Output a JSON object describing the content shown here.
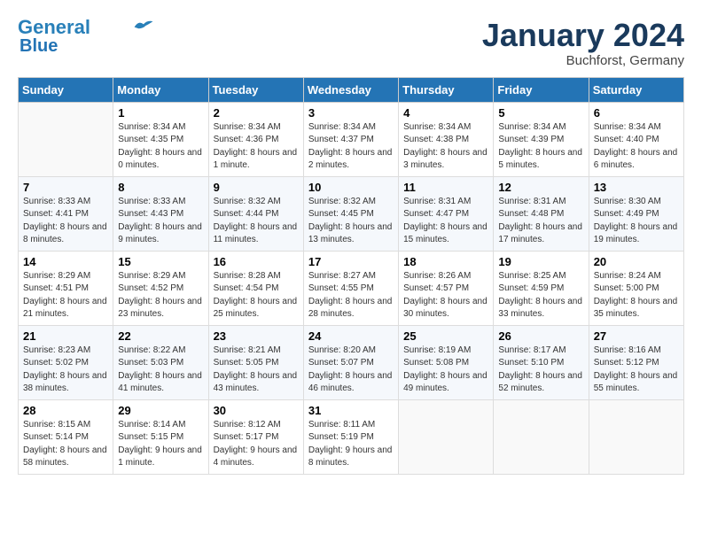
{
  "header": {
    "logo_line1": "General",
    "logo_line2": "Blue",
    "month_title": "January 2024",
    "location": "Buchforst, Germany"
  },
  "weekdays": [
    "Sunday",
    "Monday",
    "Tuesday",
    "Wednesday",
    "Thursday",
    "Friday",
    "Saturday"
  ],
  "weeks": [
    [
      {
        "day": "",
        "empty": true
      },
      {
        "day": "1",
        "sunrise": "8:34 AM",
        "sunset": "4:35 PM",
        "daylight": "8 hours and 0 minutes."
      },
      {
        "day": "2",
        "sunrise": "8:34 AM",
        "sunset": "4:36 PM",
        "daylight": "8 hours and 1 minute."
      },
      {
        "day": "3",
        "sunrise": "8:34 AM",
        "sunset": "4:37 PM",
        "daylight": "8 hours and 2 minutes."
      },
      {
        "day": "4",
        "sunrise": "8:34 AM",
        "sunset": "4:38 PM",
        "daylight": "8 hours and 3 minutes."
      },
      {
        "day": "5",
        "sunrise": "8:34 AM",
        "sunset": "4:39 PM",
        "daylight": "8 hours and 5 minutes."
      },
      {
        "day": "6",
        "sunrise": "8:34 AM",
        "sunset": "4:40 PM",
        "daylight": "8 hours and 6 minutes."
      }
    ],
    [
      {
        "day": "7",
        "sunrise": "8:33 AM",
        "sunset": "4:41 PM",
        "daylight": "8 hours and 8 minutes."
      },
      {
        "day": "8",
        "sunrise": "8:33 AM",
        "sunset": "4:43 PM",
        "daylight": "8 hours and 9 minutes."
      },
      {
        "day": "9",
        "sunrise": "8:32 AM",
        "sunset": "4:44 PM",
        "daylight": "8 hours and 11 minutes."
      },
      {
        "day": "10",
        "sunrise": "8:32 AM",
        "sunset": "4:45 PM",
        "daylight": "8 hours and 13 minutes."
      },
      {
        "day": "11",
        "sunrise": "8:31 AM",
        "sunset": "4:47 PM",
        "daylight": "8 hours and 15 minutes."
      },
      {
        "day": "12",
        "sunrise": "8:31 AM",
        "sunset": "4:48 PM",
        "daylight": "8 hours and 17 minutes."
      },
      {
        "day": "13",
        "sunrise": "8:30 AM",
        "sunset": "4:49 PM",
        "daylight": "8 hours and 19 minutes."
      }
    ],
    [
      {
        "day": "14",
        "sunrise": "8:29 AM",
        "sunset": "4:51 PM",
        "daylight": "8 hours and 21 minutes."
      },
      {
        "day": "15",
        "sunrise": "8:29 AM",
        "sunset": "4:52 PM",
        "daylight": "8 hours and 23 minutes."
      },
      {
        "day": "16",
        "sunrise": "8:28 AM",
        "sunset": "4:54 PM",
        "daylight": "8 hours and 25 minutes."
      },
      {
        "day": "17",
        "sunrise": "8:27 AM",
        "sunset": "4:55 PM",
        "daylight": "8 hours and 28 minutes."
      },
      {
        "day": "18",
        "sunrise": "8:26 AM",
        "sunset": "4:57 PM",
        "daylight": "8 hours and 30 minutes."
      },
      {
        "day": "19",
        "sunrise": "8:25 AM",
        "sunset": "4:59 PM",
        "daylight": "8 hours and 33 minutes."
      },
      {
        "day": "20",
        "sunrise": "8:24 AM",
        "sunset": "5:00 PM",
        "daylight": "8 hours and 35 minutes."
      }
    ],
    [
      {
        "day": "21",
        "sunrise": "8:23 AM",
        "sunset": "5:02 PM",
        "daylight": "8 hours and 38 minutes."
      },
      {
        "day": "22",
        "sunrise": "8:22 AM",
        "sunset": "5:03 PM",
        "daylight": "8 hours and 41 minutes."
      },
      {
        "day": "23",
        "sunrise": "8:21 AM",
        "sunset": "5:05 PM",
        "daylight": "8 hours and 43 minutes."
      },
      {
        "day": "24",
        "sunrise": "8:20 AM",
        "sunset": "5:07 PM",
        "daylight": "8 hours and 46 minutes."
      },
      {
        "day": "25",
        "sunrise": "8:19 AM",
        "sunset": "5:08 PM",
        "daylight": "8 hours and 49 minutes."
      },
      {
        "day": "26",
        "sunrise": "8:17 AM",
        "sunset": "5:10 PM",
        "daylight": "8 hours and 52 minutes."
      },
      {
        "day": "27",
        "sunrise": "8:16 AM",
        "sunset": "5:12 PM",
        "daylight": "8 hours and 55 minutes."
      }
    ],
    [
      {
        "day": "28",
        "sunrise": "8:15 AM",
        "sunset": "5:14 PM",
        "daylight": "8 hours and 58 minutes."
      },
      {
        "day": "29",
        "sunrise": "8:14 AM",
        "sunset": "5:15 PM",
        "daylight": "9 hours and 1 minute."
      },
      {
        "day": "30",
        "sunrise": "8:12 AM",
        "sunset": "5:17 PM",
        "daylight": "9 hours and 4 minutes."
      },
      {
        "day": "31",
        "sunrise": "8:11 AM",
        "sunset": "5:19 PM",
        "daylight": "9 hours and 8 minutes."
      },
      {
        "day": "",
        "empty": true
      },
      {
        "day": "",
        "empty": true
      },
      {
        "day": "",
        "empty": true
      }
    ]
  ]
}
